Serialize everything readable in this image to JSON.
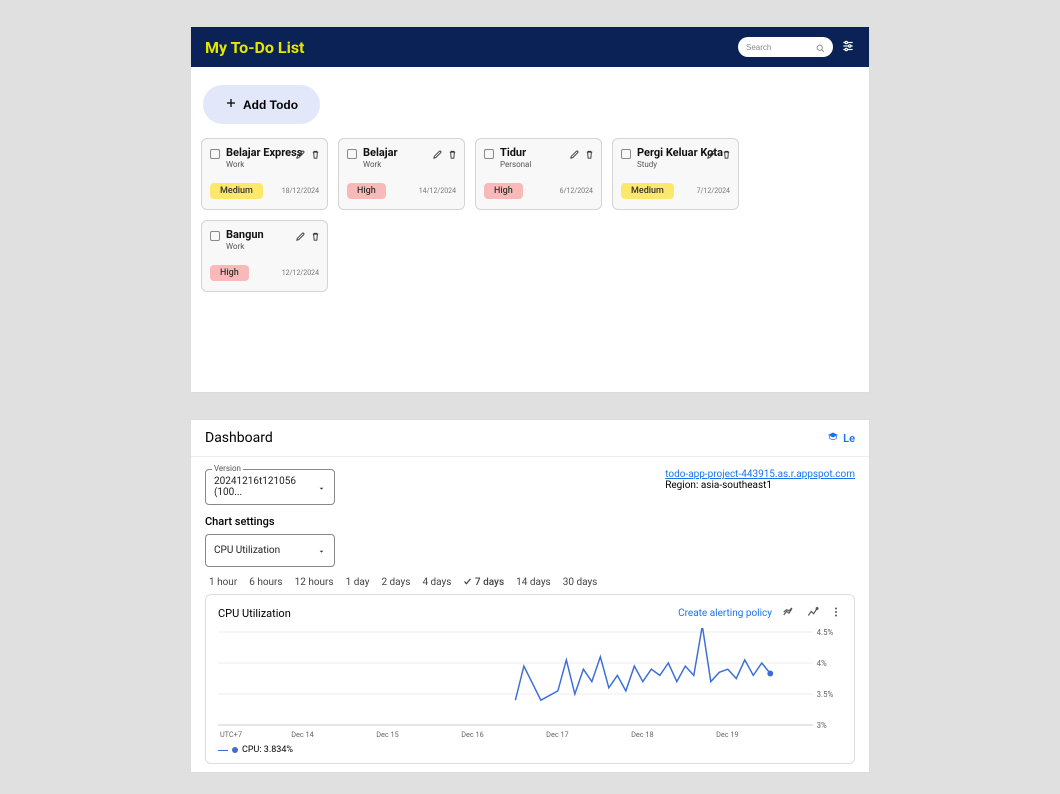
{
  "todo": {
    "title": "My To-Do List",
    "search_placeholder": "Search",
    "add_label": "Add Todo",
    "cards": [
      {
        "title": "Belajar Express",
        "category": "Work",
        "priority": "Medium",
        "priority_class": "pill-medium",
        "date": "18/12/2024"
      },
      {
        "title": "Belajar",
        "category": "Work",
        "priority": "High",
        "priority_class": "pill-high",
        "date": "14/12/2024"
      },
      {
        "title": "Tidur",
        "category": "Personal",
        "priority": "High",
        "priority_class": "pill-high",
        "date": "6/12/2024"
      },
      {
        "title": "Pergi Keluar Kota",
        "category": "Study",
        "priority": "Medium",
        "priority_class": "pill-medium",
        "date": "7/12/2024"
      },
      {
        "title": "Bangun",
        "category": "Work",
        "priority": "High",
        "priority_class": "pill-high",
        "date": "12/12/2024"
      }
    ]
  },
  "dashboard": {
    "title": "Dashboard",
    "learn_label": "Le",
    "version_legend": "Version",
    "version_value": "20241216t121056 (100...",
    "project_url": "todo-app-project-443915.as.r.appspot.com",
    "region_label": "Region: asia-southeast1",
    "chart_settings_label": "Chart settings",
    "chart_settings_value": "CPU Utilization",
    "ranges": [
      "1 hour",
      "6 hours",
      "12 hours",
      "1 day",
      "2 days",
      "4 days",
      "7 days",
      "14 days",
      "30 days"
    ],
    "selected_range": "7 days",
    "chart_title": "CPU Utilization",
    "alert_label": "Create alerting policy",
    "tz_label": "UTC+7",
    "x_ticks": [
      "Dec 14",
      "Dec 15",
      "Dec 16",
      "Dec 17",
      "Dec 18",
      "Dec 19"
    ],
    "y_ticks": [
      "4.5%",
      "4%",
      "3.5%",
      "3%"
    ],
    "legend": "CPU: 3.834%"
  },
  "chart_data": {
    "type": "line",
    "title": "CPU Utilization",
    "xlabel": "",
    "ylabel": "",
    "ylim": [
      3.0,
      4.5
    ],
    "x_categories": [
      "Dec 14",
      "Dec 15",
      "Dec 16",
      "Dec 17",
      "Dec 18",
      "Dec 19"
    ],
    "series": [
      {
        "name": "CPU",
        "color": "#3b6ed6",
        "points": [
          [
            16.5,
            3.4
          ],
          [
            16.6,
            3.95
          ],
          [
            16.8,
            3.4
          ],
          [
            17.0,
            3.55
          ],
          [
            17.1,
            4.05
          ],
          [
            17.2,
            3.5
          ],
          [
            17.3,
            3.9
          ],
          [
            17.4,
            3.7
          ],
          [
            17.5,
            4.1
          ],
          [
            17.6,
            3.6
          ],
          [
            17.7,
            3.8
          ],
          [
            17.8,
            3.55
          ],
          [
            17.9,
            3.95
          ],
          [
            18.0,
            3.7
          ],
          [
            18.1,
            3.9
          ],
          [
            18.2,
            3.8
          ],
          [
            18.3,
            4.0
          ],
          [
            18.4,
            3.7
          ],
          [
            18.5,
            3.95
          ],
          [
            18.6,
            3.8
          ],
          [
            18.7,
            4.6
          ],
          [
            18.8,
            3.7
          ],
          [
            18.9,
            3.85
          ],
          [
            19.0,
            3.9
          ],
          [
            19.1,
            3.75
          ],
          [
            19.2,
            4.05
          ],
          [
            19.3,
            3.8
          ],
          [
            19.4,
            4.0
          ],
          [
            19.5,
            3.83
          ]
        ]
      }
    ],
    "current_value": 3.834
  }
}
